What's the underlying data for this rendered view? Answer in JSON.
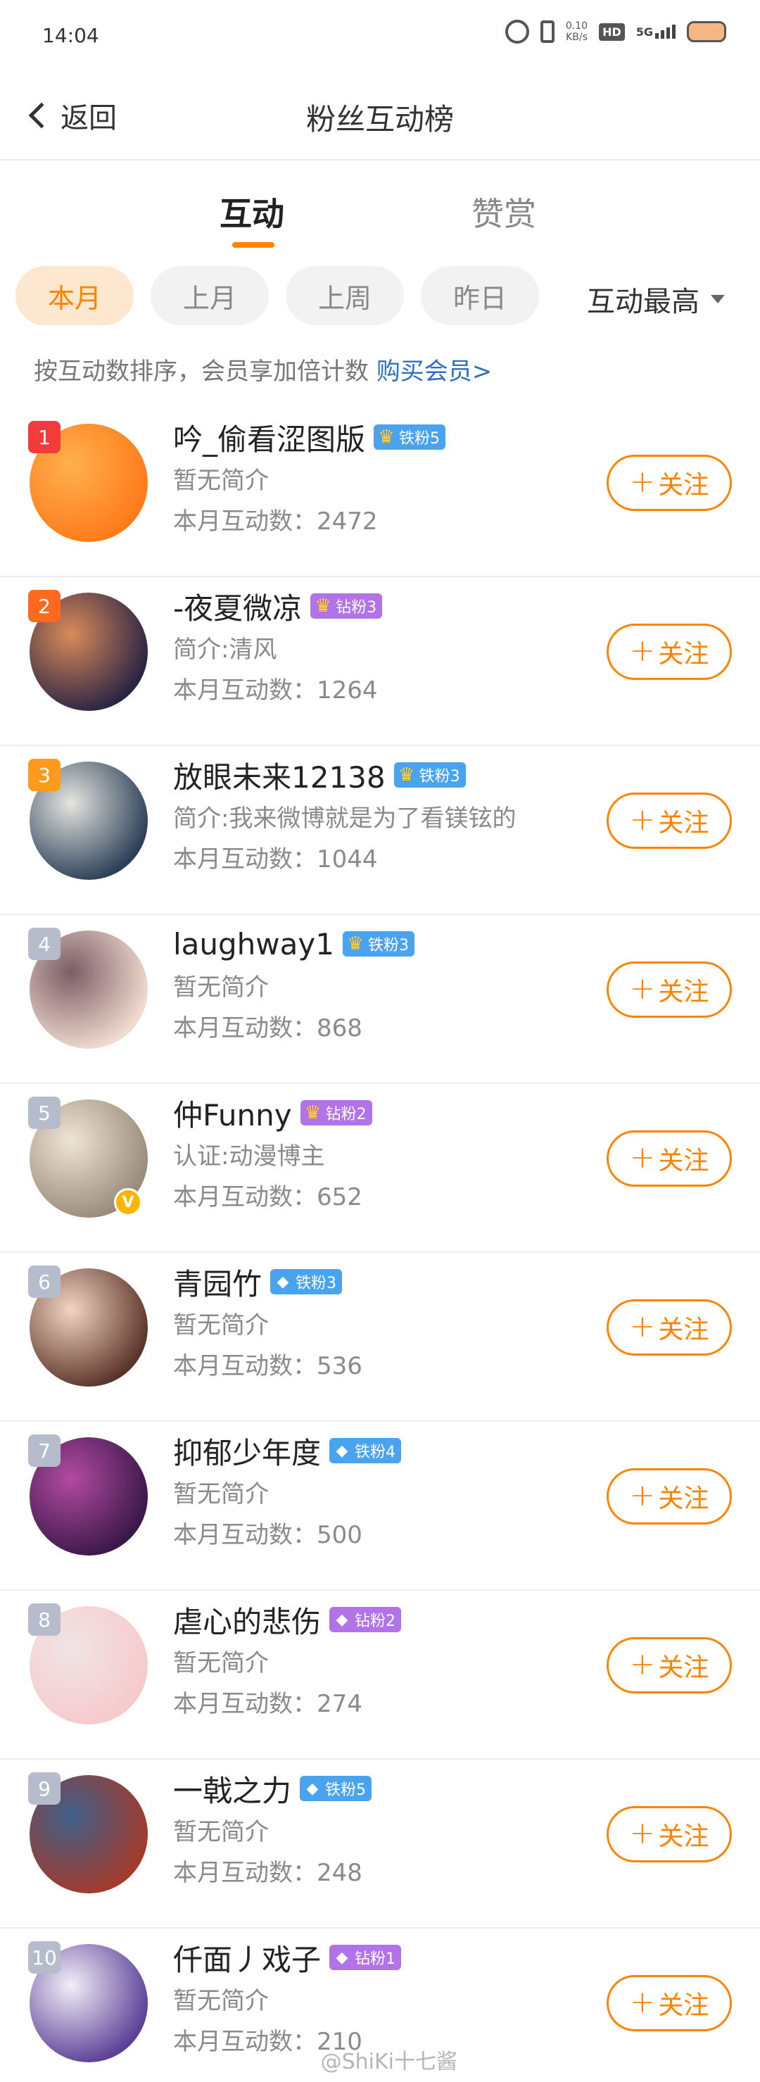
{
  "status_bar": {
    "time": "14:04",
    "net_speed": "0.10",
    "net_unit": "KB/s",
    "hd": "HD",
    "network": "5G"
  },
  "nav": {
    "back_label": "返回",
    "title": "粉丝互动榜"
  },
  "tabs": [
    {
      "label": "互动",
      "active": true
    },
    {
      "label": "赞赏",
      "active": false
    }
  ],
  "filters": [
    {
      "label": "本月",
      "active": true
    },
    {
      "label": "上月",
      "active": false
    },
    {
      "label": "上周",
      "active": false
    },
    {
      "label": "昨日",
      "active": false
    }
  ],
  "sort": {
    "label": "互动最高"
  },
  "hint": {
    "text": "按互动数排序，会员享加倍计数",
    "link": "购买会员>"
  },
  "follow_label": "关注",
  "fans": [
    {
      "rank": "1",
      "name": "吟_偷看涩图版",
      "badge": "铁粉5",
      "badge_type": "iron",
      "crown": true,
      "desc": "暂无简介",
      "count": "本月互动数：2472",
      "avatar_colors": [
        "#ff7a1a",
        "#ffb04d"
      ]
    },
    {
      "rank": "2",
      "name": "-夜夏微凉",
      "badge": "钻粉3",
      "badge_type": "diamond",
      "crown": true,
      "desc": "简介:清风",
      "count": "本月互动数：1264",
      "avatar_colors": [
        "#2a2344",
        "#d98b5a"
      ]
    },
    {
      "rank": "3",
      "name": "放眼未来12138",
      "badge": "铁粉3",
      "badge_type": "iron",
      "crown": true,
      "desc": "简介:我来微博就是为了看镁铉的",
      "count": "本月互动数：1044",
      "avatar_colors": [
        "#2b3f57",
        "#e5e5e0"
      ]
    },
    {
      "rank": "4",
      "name": "laughway1",
      "badge": "铁粉3",
      "badge_type": "iron",
      "crown": true,
      "desc": "暂无简介",
      "count": "本月互动数：868",
      "avatar_colors": [
        "#f2dcd0",
        "#7a5e66"
      ]
    },
    {
      "rank": "5",
      "name": "仲Funny",
      "badge": "钻粉2",
      "badge_type": "diamond",
      "crown": true,
      "desc": "认证:动漫博主",
      "count": "本月互动数：652",
      "avatar_colors": [
        "#9a8a7a",
        "#eee4d6"
      ],
      "verified": true
    },
    {
      "rank": "6",
      "name": "青园竹",
      "badge": "铁粉3",
      "badge_type": "iron",
      "crown": false,
      "desc": "暂无简介",
      "count": "本月互动数：536",
      "avatar_colors": [
        "#5a3328",
        "#f3d5c2"
      ]
    },
    {
      "rank": "7",
      "name": "抑郁少年度",
      "badge": "铁粉4",
      "badge_type": "iron",
      "crown": false,
      "desc": "暂无简介",
      "count": "本月互动数：500",
      "avatar_colors": [
        "#3a1848",
        "#b34aa1"
      ]
    },
    {
      "rank": "8",
      "name": "虐心的悲伤",
      "badge": "钻粉2",
      "badge_type": "diamond",
      "crown": false,
      "desc": "暂无简介",
      "count": "本月互动数：274",
      "avatar_colors": [
        "#f7c9cc",
        "#f0e5e5"
      ]
    },
    {
      "rank": "9",
      "name": "一戟之力",
      "badge": "铁粉5",
      "badge_type": "iron",
      "crown": false,
      "desc": "暂无简介",
      "count": "本月互动数：248",
      "avatar_colors": [
        "#a33a2a",
        "#3f5f8a"
      ]
    },
    {
      "rank": "10",
      "name": "仟面丿戏子",
      "badge": "钻粉1",
      "badge_type": "diamond",
      "crown": false,
      "desc": "暂无简介",
      "count": "本月互动数：210",
      "avatar_colors": [
        "#5b3f96",
        "#f2eef8"
      ]
    }
  ],
  "watermark": "@ShiKi十七酱"
}
